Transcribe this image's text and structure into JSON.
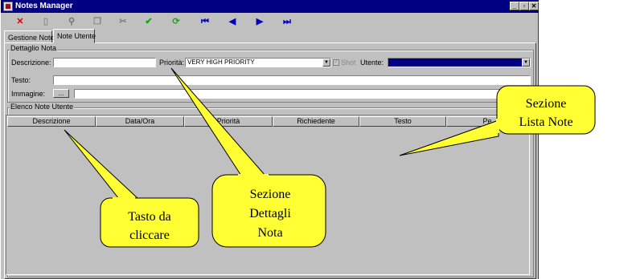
{
  "window": {
    "title": "Notes Manager"
  },
  "toolbar": {
    "buttons": [
      {
        "name": "close-record-button",
        "glyph": "✕",
        "color": "#e00000"
      },
      {
        "name": "new-doc-button",
        "glyph": "▯",
        "color": "#909090"
      },
      {
        "name": "find-button",
        "glyph": "⚲",
        "color": "#707070"
      },
      {
        "name": "copy-button",
        "glyph": "❐",
        "color": "#808080"
      },
      {
        "name": "cut-button",
        "glyph": "✂",
        "color": "#808080"
      },
      {
        "name": "confirm-button",
        "glyph": "✔",
        "color": "#00b000"
      },
      {
        "name": "refresh-button",
        "glyph": "⟳",
        "color": "#20a020"
      },
      {
        "name": "first-record-button",
        "glyph": "⏮",
        "color": "#0000c0"
      },
      {
        "name": "prev-record-button",
        "glyph": "◀",
        "color": "#0000c0"
      },
      {
        "name": "next-record-button",
        "glyph": "▶",
        "color": "#0000c0"
      },
      {
        "name": "last-record-button",
        "glyph": "⏭",
        "color": "#0000c0"
      }
    ]
  },
  "tabs": [
    "Gestione Note",
    "Note Utente"
  ],
  "dettaglio": {
    "legend": "Dettaglio Nota",
    "descrizione_label": "Descrizione:",
    "descrizione_value": "",
    "priorita_label": "Priorità:",
    "priorita_value": "VERY HIGH PRIORITY",
    "shot_label": "Shot",
    "utente_label": "Utente:",
    "utente_value": "",
    "testo_label": "Testo:",
    "testo_value": "",
    "immagine_label": "Immagine:",
    "immagine_button": "...",
    "immagine_value": ""
  },
  "elenco": {
    "legend": "Elenco Note Utente",
    "columns": [
      "Descrizione",
      "Data/Ora",
      "Priorità",
      "Richiedente",
      "Testo",
      "Pe"
    ]
  },
  "callouts": {
    "tasto": [
      "Tasto da",
      "cliccare"
    ],
    "dettagli": [
      "Sezione",
      "Dettagli",
      "Nota"
    ],
    "lista": [
      "Sezione",
      "Lista Note"
    ]
  },
  "colors": {
    "titlebar": "#000080",
    "callout_fill": "#ffff33",
    "utente_selection": "#000080"
  }
}
